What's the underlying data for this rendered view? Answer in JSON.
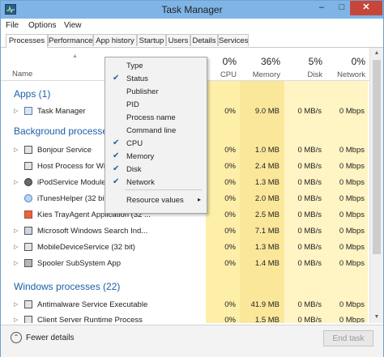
{
  "window": {
    "title": "Task Manager",
    "minimize": "–",
    "maximize": "□",
    "close": "✕"
  },
  "menu": [
    "File",
    "Options",
    "View"
  ],
  "tabs": [
    "Processes",
    "Performance",
    "App history",
    "Startup",
    "Users",
    "Details",
    "Services"
  ],
  "active_tab": "Processes",
  "columns": {
    "name_label": "Name",
    "cpu": {
      "pct": "0%",
      "label": "CPU"
    },
    "memory": {
      "pct": "36%",
      "label": "Memory"
    },
    "disk": {
      "pct": "5%",
      "label": "Disk"
    },
    "network": {
      "pct": "0%",
      "label": "Network"
    }
  },
  "groups": [
    {
      "title": "Apps (1)"
    },
    {
      "title": "Background processes"
    },
    {
      "title": "Windows processes (22)"
    }
  ],
  "rows": [
    {
      "name": "Task Manager",
      "cpu": "0%",
      "memory": "9.0 MB",
      "disk": "0 MB/s",
      "network": "0 Mbps",
      "icon": "task-manager-icon",
      "expand": "▷"
    },
    {
      "name": "Bonjour Service",
      "cpu": "0%",
      "memory": "1.0 MB",
      "disk": "0 MB/s",
      "network": "0 Mbps",
      "icon": "service-icon",
      "expand": "▷"
    },
    {
      "name": "Host Process for Wind",
      "cpu": "0%",
      "memory": "2.4 MB",
      "disk": "0 MB/s",
      "network": "0 Mbps",
      "icon": "service-icon",
      "expand": ""
    },
    {
      "name": "iPodService Module (",
      "cpu": "0%",
      "memory": "1.3 MB",
      "disk": "0 MB/s",
      "network": "0 Mbps",
      "icon": "ipod-icon",
      "expand": "▷"
    },
    {
      "name": "iTunesHelper (32 bit)",
      "cpu": "0%",
      "memory": "2.0 MB",
      "disk": "0 MB/s",
      "network": "0 Mbps",
      "icon": "itunes-icon",
      "expand": ""
    },
    {
      "name": "Kies TrayAgent Application (32 ...",
      "cpu": "0%",
      "memory": "2.5 MB",
      "disk": "0 MB/s",
      "network": "0 Mbps",
      "icon": "kies-icon",
      "expand": ""
    },
    {
      "name": "Microsoft Windows Search Ind...",
      "cpu": "0%",
      "memory": "7.1 MB",
      "disk": "0 MB/s",
      "network": "0 Mbps",
      "icon": "search-service-icon",
      "expand": "▷"
    },
    {
      "name": "MobileDeviceService (32 bit)",
      "cpu": "0%",
      "memory": "1.3 MB",
      "disk": "0 MB/s",
      "network": "0 Mbps",
      "icon": "service-icon",
      "expand": "▷"
    },
    {
      "name": "Spooler SubSystem App",
      "cpu": "0%",
      "memory": "1.4 MB",
      "disk": "0 MB/s",
      "network": "0 Mbps",
      "icon": "printer-icon",
      "expand": "▷"
    },
    {
      "name": "Antimalware Service Executable",
      "cpu": "0%",
      "memory": "41.9 MB",
      "disk": "0 MB/s",
      "network": "0 Mbps",
      "icon": "service-icon",
      "expand": "▷"
    },
    {
      "name": "Client Server Runtime Process",
      "cpu": "0%",
      "memory": "1.5 MB",
      "disk": "0 MB/s",
      "network": "0 Mbps",
      "icon": "service-icon",
      "expand": "▷"
    }
  ],
  "context_menu": [
    {
      "label": "Type",
      "checked": false,
      "submenu": false
    },
    {
      "label": "Status",
      "checked": true,
      "submenu": false
    },
    {
      "label": "Publisher",
      "checked": false,
      "submenu": false
    },
    {
      "label": "PID",
      "checked": false,
      "submenu": false
    },
    {
      "label": "Process name",
      "checked": false,
      "submenu": false
    },
    {
      "label": "Command line",
      "checked": false,
      "submenu": false
    },
    {
      "label": "CPU",
      "checked": true,
      "submenu": false
    },
    {
      "label": "Memory",
      "checked": true,
      "submenu": false
    },
    {
      "label": "Disk",
      "checked": true,
      "submenu": false
    },
    {
      "label": "Network",
      "checked": true,
      "submenu": false
    },
    {
      "label": "Resource values",
      "checked": false,
      "submenu": true
    }
  ],
  "check_glyph": "✔",
  "submenu_glyph": "▸",
  "footer": {
    "fewer_details": "Fewer details",
    "fewer_icon": "⌃",
    "end_task": "End task"
  },
  "colors": {
    "title_bar": "#7fb4e6",
    "group_text": "#1b5fa9",
    "heat_light": "#fff4c4",
    "heat_mem": "#fbe79a",
    "close": "#c7463a"
  }
}
